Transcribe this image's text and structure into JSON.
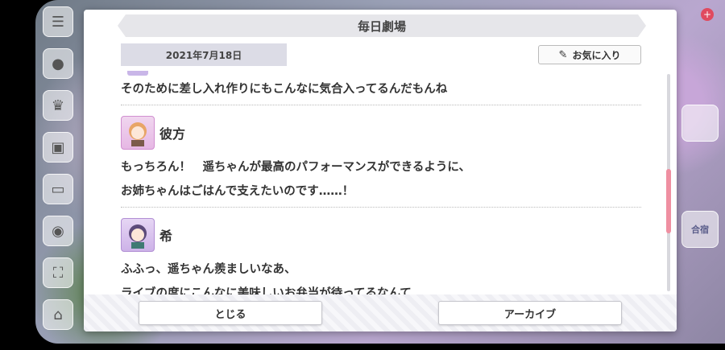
{
  "dialog": {
    "title": "毎日劇場",
    "date": "2021年7月18日",
    "favorite_label": "お気に入り"
  },
  "transcript": {
    "prev_line": "そのために差し入れ作りにもこんなに気合入ってるんだもんね",
    "entries": [
      {
        "speaker": "彼方",
        "lines": [
          "もっちろん！　遥ちゃんが最高のパフォーマンスができるように、",
          "お姉ちゃんはごはんで支えたいのです……！"
        ]
      },
      {
        "speaker": "希",
        "lines": [
          "ふふっ、遥ちゃん羨ましいなあ、",
          "ライブの度にこんなに美味しいお弁当が待ってるなんて"
        ]
      }
    ]
  },
  "footer": {
    "close_label": "とじる",
    "archive_label": "アーカイブ"
  },
  "background": {
    "right_tile_label": "合宿"
  },
  "icons": {
    "favorite": "pin-icon",
    "menu": "menu-icon"
  },
  "colors": {
    "scroll_thumb": "#ef8fa1",
    "accent_red": "#e04a5f"
  }
}
